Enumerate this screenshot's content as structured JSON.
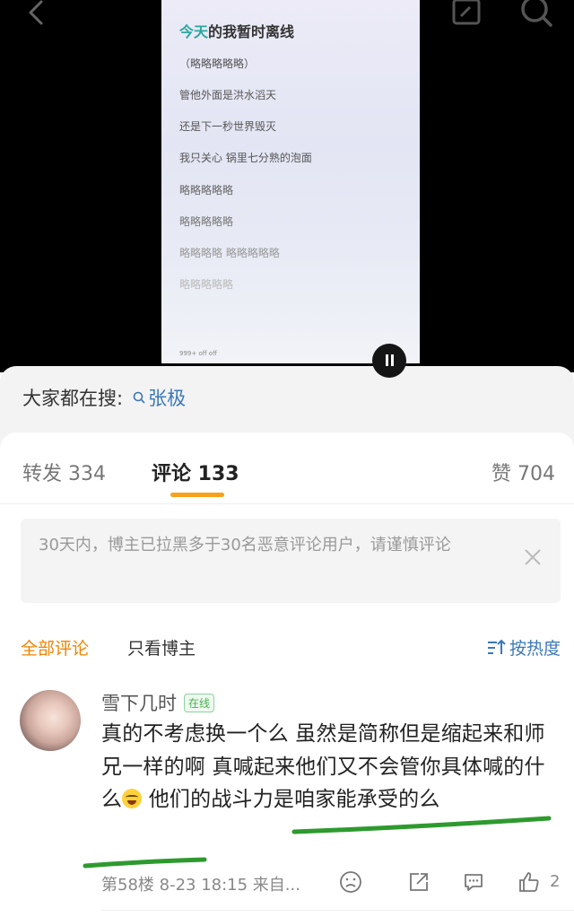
{
  "video": {
    "song_title_highlight": "今天",
    "song_title_rest": "的我暂时离线",
    "lyrics": [
      "（略略略略略）",
      "管他外面是洪水滔天",
      "还是下一秒世界毁灭",
      "我只关心 锅里七分熟的泡面",
      "略略略略略",
      "略略略略略",
      "略略略略 略略略略略",
      "略略略略略"
    ],
    "toolbar_text": "999+     off          off"
  },
  "search_bar": {
    "label": "大家都在搜:",
    "keyword": "张极"
  },
  "tabs": {
    "repost": "转发 334",
    "comment": "评论 133",
    "like": "赞 704"
  },
  "notice": {
    "text": "30天内，博主已拉黑多于30名恶意评论用户，请谨慎评论"
  },
  "filters": {
    "all": "全部评论",
    "owner_only": "只看博主",
    "sort": "按热度"
  },
  "comment": {
    "username": "雪下几时",
    "badge": "在线",
    "text_before_emoji": "真的不考虑换一个么 虽然是简称但是缩起来和师兄一样的啊 真喊起来他们又不会管你具体喊的什么",
    "text_after_emoji": " 他们的战斗力是咱家能承受的么",
    "meta": "第58楼  8-23 18:15  来自...",
    "like_count": "2"
  },
  "colors": {
    "accent_orange": "#f08300",
    "link_blue": "#3a78b8",
    "underline_green": "#2e9a2e",
    "online_green": "#4caf50"
  }
}
